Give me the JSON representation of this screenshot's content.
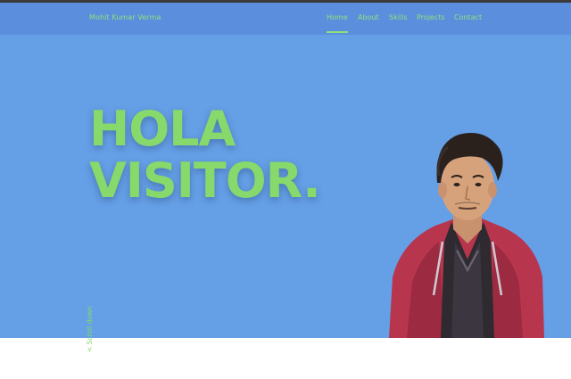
{
  "brand": "Mohit Kumar Verma",
  "nav": [
    {
      "label": "Home",
      "active": true
    },
    {
      "label": "About",
      "active": false
    },
    {
      "label": "Skills",
      "active": false
    },
    {
      "label": "Projects",
      "active": false
    },
    {
      "label": "Contact",
      "active": false
    }
  ],
  "hero": {
    "line1": "HOLA",
    "line2": "VISITOR.",
    "scroll_hint": "< Scroll down"
  },
  "colors": {
    "navbar": "#5b8fde",
    "hero_bg": "#659fe6",
    "accent_green": "#86d96a",
    "page_bg": "#ffffff"
  }
}
